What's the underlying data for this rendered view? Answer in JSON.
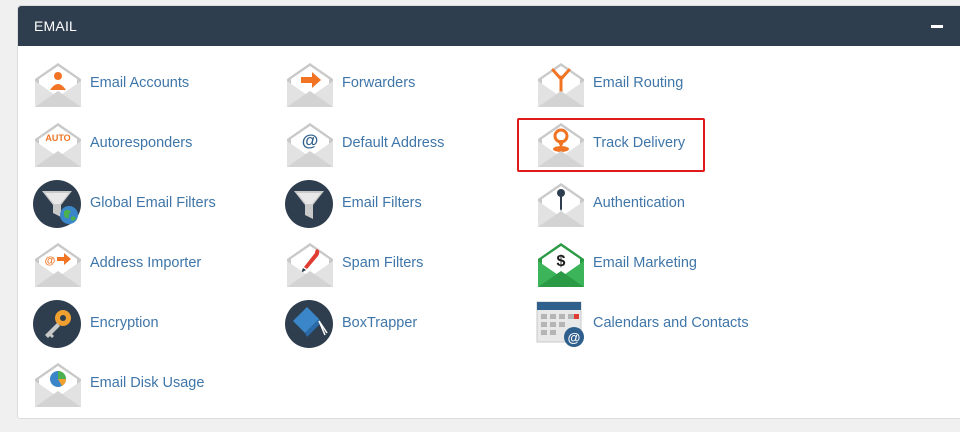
{
  "panel": {
    "title": "EMAIL",
    "collapse_symbol": "minus-icon",
    "header_color": "#2f3e4e",
    "link_color": "#3f76a9",
    "highlight_color": "#e0191c"
  },
  "items": [
    {
      "label": "Email Accounts",
      "icon": "email-accounts-icon"
    },
    {
      "label": "Forwarders",
      "icon": "forwarders-icon"
    },
    {
      "label": "Email Routing",
      "icon": "email-routing-icon"
    },
    {
      "label": "Autoresponders",
      "icon": "autoresponders-icon",
      "badge": "AUTO"
    },
    {
      "label": "Default Address",
      "icon": "default-address-icon",
      "badge": "@"
    },
    {
      "label": "Track Delivery",
      "icon": "track-delivery-icon",
      "highlighted": true
    },
    {
      "label": "Global Email Filters",
      "icon": "global-email-filters-icon"
    },
    {
      "label": "Email Filters",
      "icon": "email-filters-icon"
    },
    {
      "label": "Authentication",
      "icon": "authentication-icon"
    },
    {
      "label": "Address Importer",
      "icon": "address-importer-icon",
      "badge": "@"
    },
    {
      "label": "Spam Filters",
      "icon": "spam-filters-icon"
    },
    {
      "label": "Email Marketing",
      "icon": "email-marketing-icon",
      "badge": "$"
    },
    {
      "label": "Encryption",
      "icon": "encryption-icon"
    },
    {
      "label": "BoxTrapper",
      "icon": "boxtrapper-icon"
    },
    {
      "label": "Calendars and Contacts",
      "icon": "calendars-and-contacts-icon",
      "badge": "@"
    },
    {
      "label": "Email Disk Usage",
      "icon": "email-disk-usage-icon"
    }
  ]
}
